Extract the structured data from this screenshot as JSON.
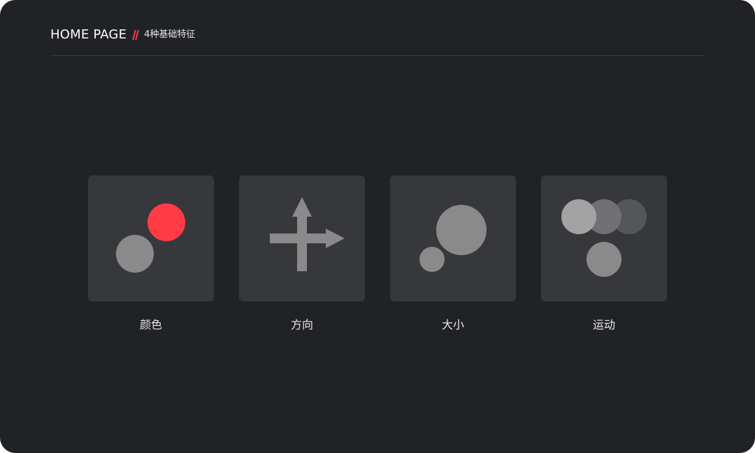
{
  "header": {
    "brand": "HOME PAGE",
    "subtitle": "4种基础特征"
  },
  "colors": {
    "background": "#212226",
    "card": "#37383c",
    "accent": "#ff3b46",
    "shape_gray": "#8a8a8a"
  },
  "cards": [
    {
      "label": "颜色",
      "icon": "two-dots-color-icon"
    },
    {
      "label": "方向",
      "icon": "direction-arrows-icon"
    },
    {
      "label": "大小",
      "icon": "size-circles-icon"
    },
    {
      "label": "运动",
      "icon": "motion-circles-icon"
    }
  ]
}
